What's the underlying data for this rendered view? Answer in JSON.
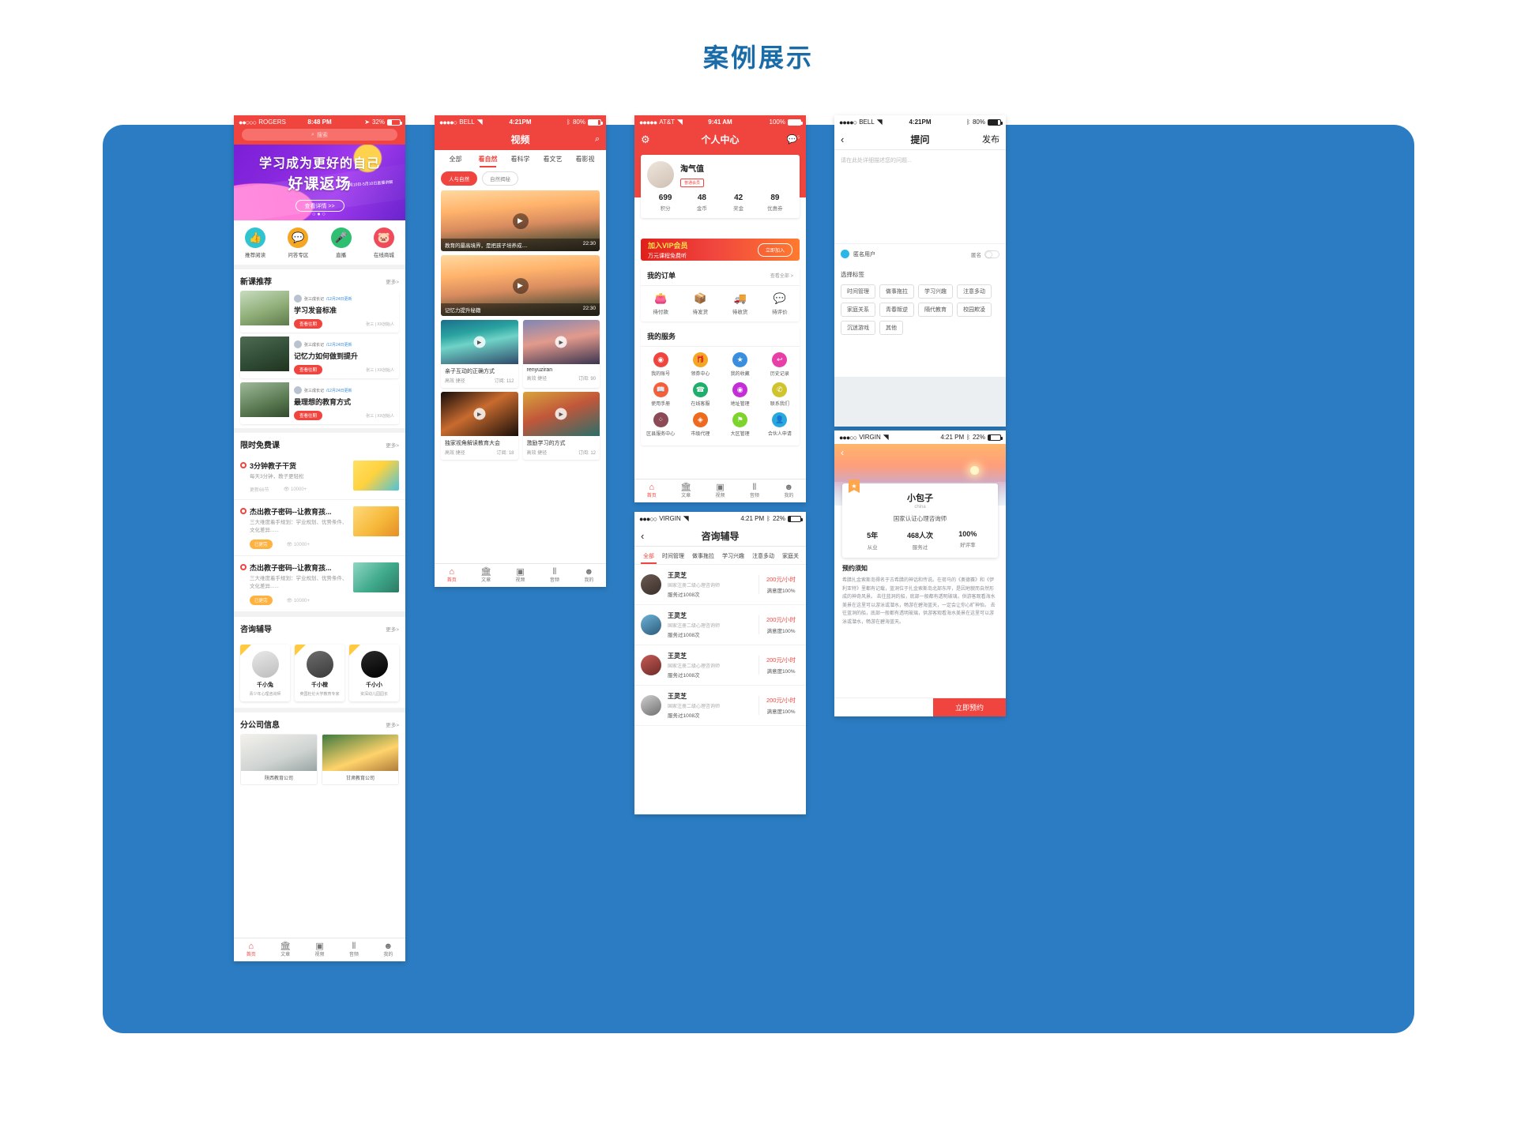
{
  "page": {
    "title": "案例展示",
    "accent": "#1a6ca8",
    "panel_bg": "#2b7cc2",
    "brand_red": "#f0453f"
  },
  "phone1": {
    "status": {
      "carrier": "ROGERS",
      "dots": "●●○○○",
      "time": "8:48 PM",
      "battery": "32%"
    },
    "search": {
      "placeholder": "搜索",
      "icon": "search-icon"
    },
    "banner": {
      "line1": "学习成为更好的自己",
      "line2": "好课返场",
      "sub": "4月10日-5月10日直播讲解",
      "cta": "查看详情 >>",
      "dots": "○●○"
    },
    "quick": [
      {
        "label": "推荐阅读",
        "icon": "thumbs-up-icon",
        "glyph": "👍",
        "color": "#2fc4cf"
      },
      {
        "label": "问答专区",
        "icon": "qa-icon",
        "glyph": "💬",
        "color": "#f5a623"
      },
      {
        "label": "直播",
        "icon": "microphone-icon",
        "glyph": "🎤",
        "color": "#2fbf71"
      },
      {
        "label": "在线商城",
        "icon": "piggy-bank-icon",
        "glyph": "🐷",
        "color": "#ef4b5b"
      }
    ],
    "new_courses": {
      "title": "新课推荐",
      "more": "更多>",
      "items": [
        {
          "author": "张三成长记",
          "date": "/12月24日更新",
          "title": "学习发音标准",
          "button": "查看往期",
          "meta": "张三 | XX创始人",
          "img": "img-kid1"
        },
        {
          "author": "张三成长记",
          "date": "/12月24日更新",
          "title": "记忆力如何做到提升",
          "button": "查看往期",
          "meta": "张三 | XX创始人",
          "img": "img-kid2"
        },
        {
          "author": "张三成长记",
          "date": "/12月24日更新",
          "title": "最理想的教育方式",
          "button": "查看往期",
          "meta": "张三 | XX创始人",
          "img": "img-kid3"
        }
      ]
    },
    "free_courses": {
      "title": "限时免费课",
      "more": "更多>",
      "items": [
        {
          "title": "3分钟教子干货",
          "desc": "每天3分钟，教子更轻松",
          "status": "更新66节",
          "badge": "",
          "views": "10000+",
          "img": "img-ad1"
        },
        {
          "title": "杰出教子密码--让教育孩...",
          "desc": "三大维度着手规划：学业规划、优势条件、文化差异......",
          "status": "",
          "badge": "已更完",
          "views": "10000+",
          "img": "img-ad2"
        },
        {
          "title": "杰出教子密码--让教育孩...",
          "desc": "三大维度着手规划：学业规划、优势条件、文化差异......",
          "status": "",
          "badge": "已更完",
          "views": "10000+",
          "img": "img-ad3"
        }
      ]
    },
    "consult": {
      "title": "咨询辅导",
      "more": "更多>",
      "items": [
        {
          "name": "千小兔",
          "desc": "青少年心理咨询师",
          "img": "img-t1"
        },
        {
          "name": "千小橙",
          "desc": "英国杜伦大学教育专家",
          "img": "img-t2"
        },
        {
          "name": "千小小",
          "desc": "资深幼儿园园长",
          "img": "img-t3"
        }
      ]
    },
    "branch": {
      "title": "分公司信息",
      "more": "更多>",
      "items": [
        {
          "name": "陕西教育公司",
          "img": "img-b1"
        },
        {
          "name": "甘肃教育公司",
          "img": "img-b2"
        }
      ]
    },
    "tabbar": [
      {
        "label": "首页",
        "icon": "home-icon",
        "glyph": "⌂",
        "active": true
      },
      {
        "label": "文章",
        "icon": "article-icon",
        "glyph": "🏛",
        "active": false
      },
      {
        "label": "视频",
        "icon": "video-icon",
        "glyph": "▣",
        "active": false
      },
      {
        "label": "音频",
        "icon": "audio-wave-icon",
        "glyph": "⦀",
        "active": false
      },
      {
        "label": "我的",
        "icon": "user-icon",
        "glyph": "☻",
        "active": false
      }
    ]
  },
  "phone2": {
    "status": {
      "carrier": "BELL",
      "dots": "●●●●○",
      "time": "4:21PM",
      "battery": "80%"
    },
    "navbar": {
      "title": "视频",
      "right_icon": "search-icon"
    },
    "tabs": [
      {
        "label": "全部",
        "active": false
      },
      {
        "label": "看自然",
        "active": true
      },
      {
        "label": "看科学",
        "active": false
      },
      {
        "label": "看文艺",
        "active": false
      },
      {
        "label": "看影视",
        "active": false
      }
    ],
    "chips": [
      {
        "label": "人与自然",
        "on": true
      },
      {
        "label": "自然揭秘",
        "on": false
      }
    ],
    "featured": [
      {
        "title": "教育的最高境界，是把孩子培养成....",
        "duration": "22:30",
        "img": "img-sun"
      },
      {
        "title": "记忆力提升秘籍",
        "duration": "22:30",
        "img": "img-sun"
      }
    ],
    "grid": [
      {
        "title": "亲子互动的正确方式",
        "tags": "高效 捷径",
        "subs": "订阅: 112",
        "img": "img-aurora"
      },
      {
        "title": "renyuziran",
        "tags": "高效 捷径",
        "subs": "订阅: 90",
        "img": "img-city"
      },
      {
        "title": "独家视角解读教育大会",
        "tags": "高效 捷径",
        "subs": "订阅: 18",
        "img": "img-hand"
      },
      {
        "title": "激励学习的方式",
        "tags": "高效 捷径",
        "subs": "订阅: 12",
        "img": "img-boat"
      }
    ],
    "tabbar": [
      {
        "label": "首页",
        "icon": "home-icon",
        "glyph": "⌂",
        "active": true
      },
      {
        "label": "文章",
        "icon": "article-icon",
        "glyph": "🏛",
        "active": false
      },
      {
        "label": "视频",
        "icon": "video-icon",
        "glyph": "▣",
        "active": false
      },
      {
        "label": "音频",
        "icon": "audio-wave-icon",
        "glyph": "⦀",
        "active": false
      },
      {
        "label": "我的",
        "icon": "user-icon",
        "glyph": "☻",
        "active": false
      }
    ]
  },
  "phone3": {
    "status": {
      "carrier": "AT&T",
      "dots": "●●●●●",
      "time": "9:41 AM",
      "battery": "100%"
    },
    "navbar": {
      "title": "个人中心",
      "left_icon": "gear-icon",
      "right_icon": "message-icon",
      "badge": "5"
    },
    "profile": {
      "name": "淘气值",
      "vip_tag": "普通会员",
      "avatar": "cat-avatar",
      "stats": [
        {
          "value": "699",
          "label": "积分"
        },
        {
          "value": "48",
          "label": "金币"
        },
        {
          "value": "42",
          "label": "奖金"
        },
        {
          "value": "89",
          "label": "优惠券"
        }
      ]
    },
    "vip_banner": {
      "title": "加入VIP会员",
      "sub": "万元课程免费听",
      "button": "立即加入"
    },
    "orders": {
      "title": "我的订单",
      "more": "查看全部 >",
      "items": [
        {
          "label": "待付款",
          "icon": "wallet-icon",
          "glyph": "👛"
        },
        {
          "label": "待发货",
          "icon": "package-icon",
          "glyph": "📦"
        },
        {
          "label": "待收货",
          "icon": "truck-icon",
          "glyph": "🚚"
        },
        {
          "label": "待评价",
          "icon": "comment-icon",
          "glyph": "💬"
        }
      ]
    },
    "services": {
      "title": "我的服务",
      "items": [
        {
          "label": "我的账号",
          "icon": "account-icon",
          "glyph": "◉",
          "color": "#f0453f"
        },
        {
          "label": "领券中心",
          "icon": "coupon-icon",
          "glyph": "🎁",
          "color": "#f5a623"
        },
        {
          "label": "我的收藏",
          "icon": "star-icon",
          "glyph": "★",
          "color": "#3a8ede"
        },
        {
          "label": "历史记录",
          "icon": "history-icon",
          "glyph": "↩",
          "color": "#e83ea8"
        },
        {
          "label": "使用手册",
          "icon": "manual-icon",
          "glyph": "📖",
          "color": "#f5603a"
        },
        {
          "label": "在线客服",
          "icon": "headset-icon",
          "glyph": "☎",
          "color": "#1fae6b"
        },
        {
          "label": "地址管理",
          "icon": "location-icon",
          "glyph": "◉",
          "color": "#c42ed6"
        },
        {
          "label": "联系我们",
          "icon": "phone-icon",
          "glyph": "✆",
          "color": "#cfc42e"
        },
        {
          "label": "区县服务中心",
          "icon": "network-icon",
          "glyph": "⁘",
          "color": "#8b4a55"
        },
        {
          "label": "市级代理",
          "icon": "agency-icon",
          "glyph": "◈",
          "color": "#ee6a1f"
        },
        {
          "label": "大区管理",
          "icon": "region-icon",
          "glyph": "⚑",
          "color": "#7dd42a"
        },
        {
          "label": "合伙人申请",
          "icon": "partner-icon",
          "glyph": "👤",
          "color": "#29a8dd"
        }
      ]
    },
    "tabbar": [
      {
        "label": "首页",
        "icon": "home-icon",
        "glyph": "⌂",
        "active": true
      },
      {
        "label": "文章",
        "icon": "article-icon",
        "glyph": "🏛",
        "active": false
      },
      {
        "label": "视频",
        "icon": "video-icon",
        "glyph": "▣",
        "active": false
      },
      {
        "label": "音频",
        "icon": "audio-wave-icon",
        "glyph": "⦀",
        "active": false
      },
      {
        "label": "我的",
        "icon": "user-icon",
        "glyph": "☻",
        "active": false
      }
    ]
  },
  "phone4": {
    "status": {
      "carrier": "VIRGIN",
      "dots": "●●●○○",
      "time": "4:21 PM",
      "battery": "22%"
    },
    "navbar": {
      "title": "咨询辅导",
      "left_icon": "back-chevron-icon"
    },
    "tabs": [
      {
        "label": "全部",
        "active": true
      },
      {
        "label": "时间管理",
        "active": false
      },
      {
        "label": "做事拖拉",
        "active": false
      },
      {
        "label": "学习兴趣",
        "active": false
      },
      {
        "label": "注意多动",
        "active": false
      },
      {
        "label": "家庭关",
        "active": false
      }
    ],
    "rows": [
      {
        "name": "王灵芝",
        "cert": "国家注册二级心理咨询师",
        "served": "服务过1008次",
        "price": "200元/小时",
        "rate": "满意度100%",
        "avatar": "av-g1"
      },
      {
        "name": "王灵芝",
        "cert": "国家注册二级心理咨询师",
        "served": "服务过1008次",
        "price": "200元/小时",
        "rate": "满意度100%",
        "avatar": "av-g2"
      },
      {
        "name": "王灵芝",
        "cert": "国家注册二级心理咨询师",
        "served": "服务过1008次",
        "price": "200元/小时",
        "rate": "满意度100%",
        "avatar": "av-g3"
      },
      {
        "name": "王灵芝",
        "cert": "国家注册二级心理咨询师",
        "served": "服务过1008次",
        "price": "200元/小时",
        "rate": "满意度100%",
        "avatar": "av-g4"
      }
    ]
  },
  "phone5": {
    "status": {
      "carrier": "BELL",
      "dots": "●●●●○",
      "time": "4:21PM",
      "battery": "80%"
    },
    "navbar": {
      "title": "提问",
      "left_icon": "back-chevron-icon",
      "right": "发布"
    },
    "editor": {
      "placeholder": "请在此处详细描述您的问题..."
    },
    "anon": {
      "name": "匿名用户",
      "toggle_label": "匿名"
    },
    "tags": {
      "title": "选择标签",
      "items": [
        "时间管理",
        "做事拖拉",
        "学习兴趣",
        "注意多动",
        "家庭关系",
        "青春叛逆",
        "隔代教育",
        "校园欺凌",
        "沉迷游戏",
        "其他"
      ]
    }
  },
  "phone6": {
    "status": {
      "carrier": "VIRGIN",
      "dots": "●●●○○",
      "time": "4:21 PM",
      "battery": "22%"
    },
    "navbar": {
      "left_icon": "back-chevron-icon"
    },
    "profile": {
      "name": "小包子",
      "en": "china",
      "cert": "国家认证心理咨询师",
      "stats": [
        {
          "value": "5年",
          "label": "从业"
        },
        {
          "value": "468人次",
          "label": "服务过"
        },
        {
          "value": "100%",
          "label": "好评率"
        }
      ]
    },
    "notice": {
      "title": "预约须知",
      "body": "希腊扎金索斯岛得名于古希腊的神话和传说。在荷马的《奥德赛》和《伊利亚特》里都有记载，蓝洞位于扎金索斯岛北部东岸，是因地貌而自然形成的神奇风景。\n去往蓝洞的船，底部一般都有透明玻璃，供游客观看海水美景在这里可以游泳或潜水，畅游在碧海蓝天，一定会让你心旷神怡。\n去往蓝洞的船，底部一般都有透明玻璃，供游客观看海水美景在这里可以游泳或潜水，畅游在碧海蓝天。"
    },
    "book_button": "立即预约"
  }
}
